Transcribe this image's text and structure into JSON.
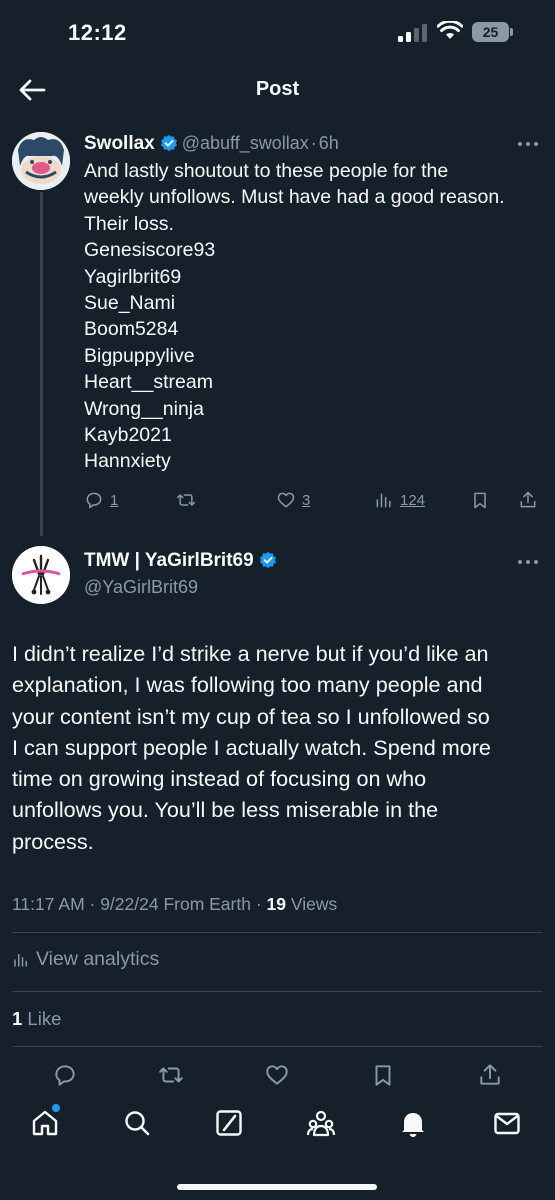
{
  "status_bar": {
    "time": "12:12",
    "battery": "25"
  },
  "header": {
    "title": "Post"
  },
  "tweet1": {
    "name": "Swollax",
    "handle": "@abuff_swollax",
    "separator": "·",
    "age": "6h",
    "lines": [
      "And lastly shoutout to these people for the",
      "weekly unfollows. Must have had a good reason.",
      "Their loss.",
      "Genesiscore93",
      "Yagirlbrit69",
      "Sue_Nami",
      "Boom5284",
      "Bigpuppylive",
      "Heart__stream",
      "Wrong__ninja",
      "Kayb2021",
      "Hannxiety"
    ],
    "stats": {
      "replies": "1",
      "likes": "3",
      "views": "124"
    }
  },
  "tweet2": {
    "name": "TMW | YaGirlBrit69",
    "handle": "@YaGirlBrit69",
    "lines": [
      "I didn’t realize I’d strike a nerve but if you’d like an",
      "explanation, I was following too many people and",
      "your content isn’t my cup of tea so I unfollowed so",
      "I can support people I actually watch. Spend more",
      "time on growing instead of focusing on who",
      "unfollows you. You’ll be less miserable in the",
      "process."
    ],
    "meta_time": "11:17 AM · 9/22/24 From Earth ·",
    "meta_views_count": "19",
    "meta_views_label": " Views",
    "analytics_label": "View analytics",
    "likes_count": "1",
    "likes_label": " Like"
  },
  "colors": {
    "background": "#15202b",
    "text": "#f7f9f9",
    "secondary": "#8b98a5",
    "accent": "#1d9bf0",
    "divider": "#38444d"
  },
  "icons": {
    "actions": [
      "reply-icon",
      "repost-icon",
      "like-icon",
      "views-icon",
      "bookmark-icon",
      "share-icon"
    ],
    "tabs": [
      "home-icon",
      "search-icon",
      "grok-icon",
      "communities-icon",
      "notifications-icon",
      "messages-icon"
    ]
  }
}
